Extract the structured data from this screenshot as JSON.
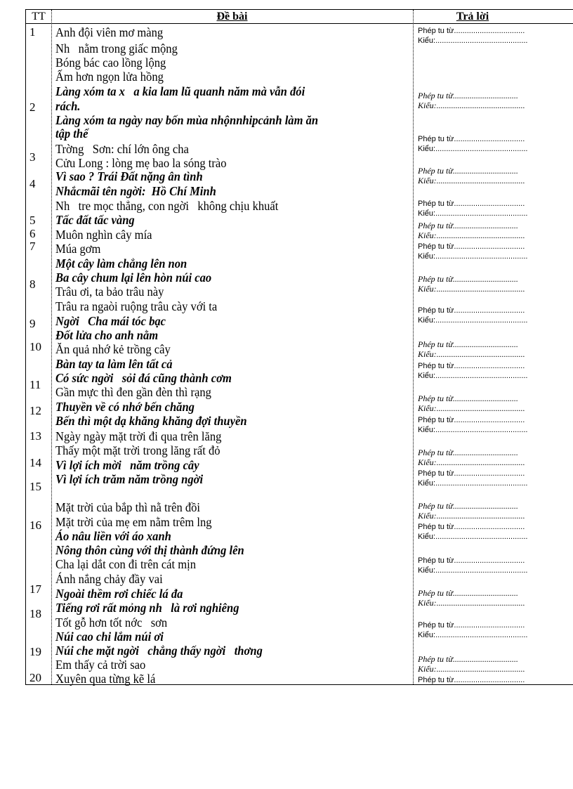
{
  "header": {
    "col_tt": "TT",
    "col_question": "Đề bài",
    "col_answer": "Trả lời"
  },
  "numbers": [
    "1",
    "2",
    "3",
    "4",
    "5",
    "6",
    "7",
    "8",
    "9",
    "10",
    "11",
    "12",
    "13",
    "14",
    "15",
    "16",
    "17",
    "18",
    "19",
    "20"
  ],
  "lines": [
    {
      "text": "Anh đội viên mơ màng",
      "emphasis": false
    },
    {
      "text": "Nh   nằm trong giấc mộng",
      "emphasis": false
    },
    {
      "text": "Bóng bác cao lồng lộng",
      "emphasis": false
    },
    {
      "text": "Ấm hơn ngọn lửa hồng",
      "emphasis": false
    },
    {
      "text": "Làng xóm ta x   a kia lam lũ quanh năm mà vẫn đói",
      "emphasis": true
    },
    {
      "text": "rách.",
      "emphasis": true
    },
    {
      "text": "Làng xóm ta ngày nay bốn mùa nhộnnhipcảnh làm ăn",
      "emphasis": true
    },
    {
      "text": "tập thể",
      "emphasis": true
    },
    {
      "text": "Trờng   Sơn: chí lớn ông cha",
      "emphasis": false
    },
    {
      "text": "Cửu Long : lòng mẹ bao la sóng trào",
      "emphasis": false
    },
    {
      "text": "Vì sao ? Trái Đất nặng ân tình",
      "emphasis": true
    },
    {
      "text": "Nhắcmãi tên ngời:  Hồ Chí Minh",
      "emphasis": true
    },
    {
      "text": "Nh   tre mọc thẳng, con ngời   không chịu khuất",
      "emphasis": false
    },
    {
      "text": "Tấc đất tấc vàng",
      "emphasis": true
    },
    {
      "text": "Muôn nghìn cây mía",
      "emphasis": false
    },
    {
      "text": "Múa gơm",
      "emphasis": false
    },
    {
      "text": "Một cây làm chẳng lên non",
      "emphasis": true
    },
    {
      "text": "Ba cây chum lại lên hòn núi cao",
      "emphasis": true
    },
    {
      "text": "Trâu ơi, ta bảo trâu này",
      "emphasis": false
    },
    {
      "text": "Trâu ra ngaòi ruộng trâu cày với ta",
      "emphasis": false
    },
    {
      "text": "Ngời   Cha mái tóc bạc",
      "emphasis": true
    },
    {
      "text": "Đốt lửa cho anh nằm",
      "emphasis": true
    },
    {
      "text": "Ăn quả nhớ kẻ trồng cây",
      "emphasis": false
    },
    {
      "text": "Bàn tay ta làm lên tất cả",
      "emphasis": true
    },
    {
      "text": "Có sức ngời   sỏi đá cũng thành cơm",
      "emphasis": true
    },
    {
      "text": "Gần mực thì đen gần đèn thì rạng",
      "emphasis": false
    },
    {
      "text": "Thuyền về có nhớ bến chăng",
      "emphasis": true
    },
    {
      "text": "Bến thì một dạ khăng khăng đợi thuyền",
      "emphasis": true
    },
    {
      "text": "Ngày ngày mặt trời đi qua trên lăng",
      "emphasis": false
    },
    {
      "text": "Thấy một mặt trời trong lăng rất đỏ",
      "emphasis": false
    },
    {
      "text": "Vì lợi ích mời   năm trồng cây",
      "emphasis": true
    },
    {
      "text": "Vì lợi ích trăm năm trồng ngời",
      "emphasis": true
    },
    {
      "text": "Mặt trời của bắp thì nằ trên đồi",
      "emphasis": false
    },
    {
      "text": "Mặt trời của mẹ em nằm trêm lng",
      "emphasis": false
    },
    {
      "text": "Áo nâu liền với áo xanh",
      "emphasis": true
    },
    {
      "text": "Nông thôn cùng với thị thành đứng lên",
      "emphasis": true
    },
    {
      "text": "Cha lại dắt con đi trên cát mịn",
      "emphasis": false
    },
    {
      "text": "Ánh nắng chảy đầy vai",
      "emphasis": false
    },
    {
      "text": "Ngoài thềm rơi chiếc lá đa",
      "emphasis": true
    },
    {
      "text": "Tiếng rơi rất mỏng nh   là rơi nghiêng",
      "emphasis": true
    },
    {
      "text": "Tốt gỗ hơn tốt nớc   sơn",
      "emphasis": false
    },
    {
      "text": "Núi cao chi lắm núi ơi",
      "emphasis": true
    },
    {
      "text": "Núi che mặt ngời   chẳng thấy ngời   thơng",
      "emphasis": true
    },
    {
      "text": "Em thấy cả trời sao",
      "emphasis": false
    },
    {
      "text": "Xuyên qua từng kẽ lá",
      "emphasis": false
    }
  ],
  "answer_labels": {
    "figure": "Phép tu từ.................................",
    "type": "Kiểu:...........................................",
    "figure_italic": "Phép tu từ...............................",
    "type_italic": "Kiểu:.........................................."
  },
  "answers_italic": [
    false,
    true,
    false,
    true,
    false,
    true,
    false,
    true,
    false,
    true,
    false,
    true,
    false,
    true,
    false,
    true,
    false,
    false,
    true,
    false,
    true,
    false
  ]
}
